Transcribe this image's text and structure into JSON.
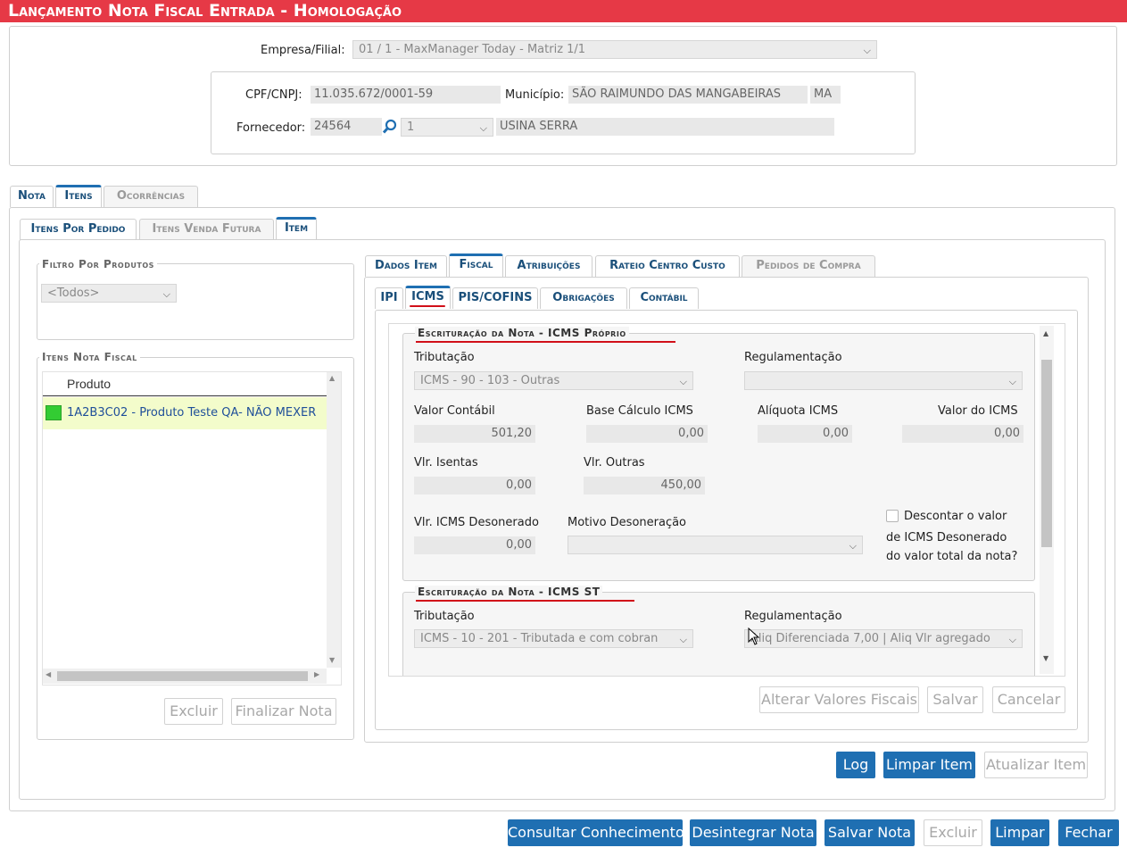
{
  "window": {
    "title": "Lançamento Nota Fiscal Entrada  - Homologação"
  },
  "header": {
    "empresa_label": "Empresa/Filial:",
    "empresa_value": "01 / 1 - MaxManager Today - Matriz 1/1",
    "cnpj_label": "CPF/CNPJ:",
    "cnpj_value": "11.035.672/0001-59",
    "municipio_label": "Município:",
    "municipio_value": "SÃO RAIMUNDO DAS MANGABEIRAS",
    "uf_value": "MA",
    "fornecedor_label": "Fornecedor:",
    "fornecedor_code": "24564",
    "fornecedor_seq": "1",
    "fornecedor_name": "USINA SERRA"
  },
  "main_tabs": [
    {
      "label": "Nota",
      "state": "normal"
    },
    {
      "label": "Itens",
      "state": "active"
    },
    {
      "label": "Ocorrências",
      "state": "disabled"
    }
  ],
  "sub_tabs": [
    {
      "label": "Itens Por Pedido",
      "state": "normal"
    },
    {
      "label": "Itens Venda Futura",
      "state": "disabled"
    },
    {
      "label": "Item",
      "state": "active"
    }
  ],
  "left": {
    "filtro_legend": "Filtro Por Produtos",
    "filtro_value": "<Todos>",
    "itens_legend": "Itens Nota Fiscal",
    "column_header": "Produto",
    "rows": [
      {
        "status_color": "#33cc33",
        "produto": "1A2B3C02 - Produto Teste QA- NÃO MEXER"
      }
    ],
    "excluir_label": "Excluir",
    "finalizar_label": "Finalizar Nota"
  },
  "item_tabs": [
    {
      "label": "Dados Item",
      "state": "normal"
    },
    {
      "label": "Fiscal",
      "state": "active"
    },
    {
      "label": "Atribuições",
      "state": "normal"
    },
    {
      "label": "Rateio Centro Custo",
      "state": "normal"
    },
    {
      "label": "Pedidos de Compra",
      "state": "disabled"
    }
  ],
  "fiscal_tabs": [
    {
      "label": "IPI",
      "state": "normal"
    },
    {
      "label": "ICMS",
      "state": "active"
    },
    {
      "label": "PIS/COFINS",
      "state": "normal"
    },
    {
      "label": "Obrigações",
      "state": "normal"
    },
    {
      "label": "Contábil",
      "state": "normal"
    }
  ],
  "icms_proprio": {
    "legend": "Escrituração da Nota - ICMS Próprio",
    "tributacao_label": "Tributação",
    "tributacao_value": "ICMS - 90 - 103 - Outras",
    "regulamentacao_label": "Regulamentação",
    "regulamentacao_value": "",
    "valor_contabil_label": "Valor Contábil",
    "valor_contabil": "501,20",
    "base_calculo_label": "Base Cálculo ICMS",
    "base_calculo": "0,00",
    "aliquota_label": "Alíquota ICMS",
    "aliquota": "0,00",
    "valor_icms_label": "Valor do ICMS",
    "valor_icms": "0,00",
    "isentas_label": "Vlr. Isentas",
    "isentas": "0,00",
    "outras_label": "Vlr. Outras",
    "outras": "450,00",
    "desonerado_label": "Vlr. ICMS Desonerado",
    "desonerado": "0,00",
    "motivo_label": "Motivo Desoneração",
    "motivo_value": "",
    "descontar_line1": "Descontar o valor",
    "descontar_line2": "de ICMS Desonerado",
    "descontar_line3": "do valor total da nota?"
  },
  "icms_st": {
    "legend": "Escrituração da Nota - ICMS ST",
    "tributacao_label": "Tributação",
    "tributacao_value": "ICMS - 10 - 201 - Tributada e com cobran",
    "regulamentacao_label": "Regulamentação",
    "regulamentacao_value": "Aliq Diferenciada 7,00 | Aliq Vlr agregado"
  },
  "fiscal_buttons": {
    "alterar": "Alterar Valores Fiscais",
    "salvar": "Salvar",
    "cancelar": "Cancelar"
  },
  "item_buttons": {
    "log": "Log",
    "limpar_item": "Limpar Item",
    "atualizar_item": "Atualizar Item"
  },
  "footer_buttons": {
    "consultar": "Consultar Conhecimento",
    "desintegrar": "Desintegrar Nota",
    "salvar_nota": "Salvar Nota",
    "excluir": "Excluir",
    "limpar": "Limpar",
    "fechar": "Fechar"
  },
  "colors": {
    "titlebar": "#e63946",
    "primary_button": "#1f6fb2",
    "underline": "#d10f19",
    "selected_row": "#f3fccb"
  }
}
